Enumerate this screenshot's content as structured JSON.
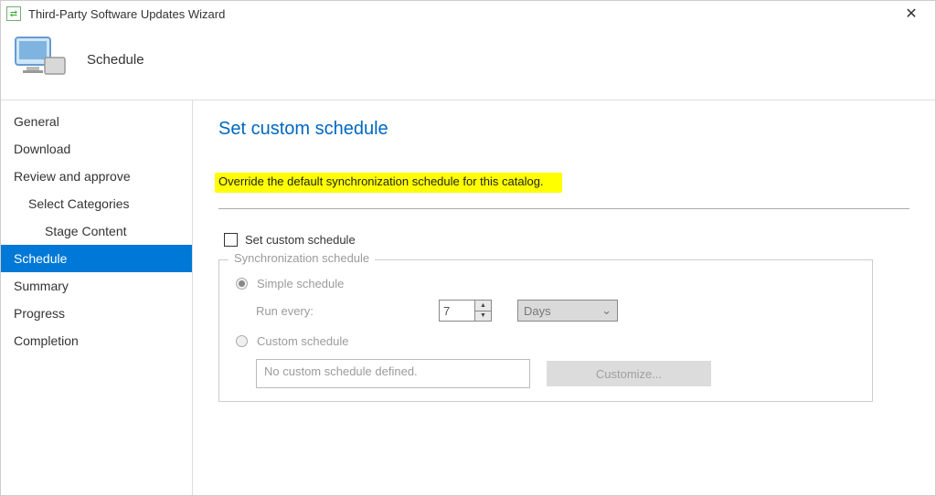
{
  "window": {
    "title": "Third-Party Software Updates Wizard"
  },
  "header": {
    "stepName": "Schedule"
  },
  "sidebar": {
    "items": [
      {
        "label": "General",
        "indent": 0,
        "active": false
      },
      {
        "label": "Download",
        "indent": 0,
        "active": false
      },
      {
        "label": "Review and approve",
        "indent": 0,
        "active": false
      },
      {
        "label": "Select Categories",
        "indent": 1,
        "active": false
      },
      {
        "label": "Stage Content",
        "indent": 2,
        "active": false
      },
      {
        "label": "Schedule",
        "indent": 0,
        "active": true
      },
      {
        "label": "Summary",
        "indent": 0,
        "active": false
      },
      {
        "label": "Progress",
        "indent": 0,
        "active": false
      },
      {
        "label": "Completion",
        "indent": 0,
        "active": false
      }
    ]
  },
  "content": {
    "heading": "Set custom schedule",
    "highlightText": "Override the default synchronization schedule for this catalog.",
    "checkboxLabel": "Set custom schedule",
    "fieldset": {
      "legend": "Synchronization schedule",
      "simpleLabel": "Simple schedule",
      "runEveryLabel": "Run every:",
      "runEveryValue": "7",
      "runEveryUnit": "Days",
      "customLabel": "Custom schedule",
      "customBoxText": "No custom schedule defined.",
      "customizeButton": "Customize..."
    }
  }
}
